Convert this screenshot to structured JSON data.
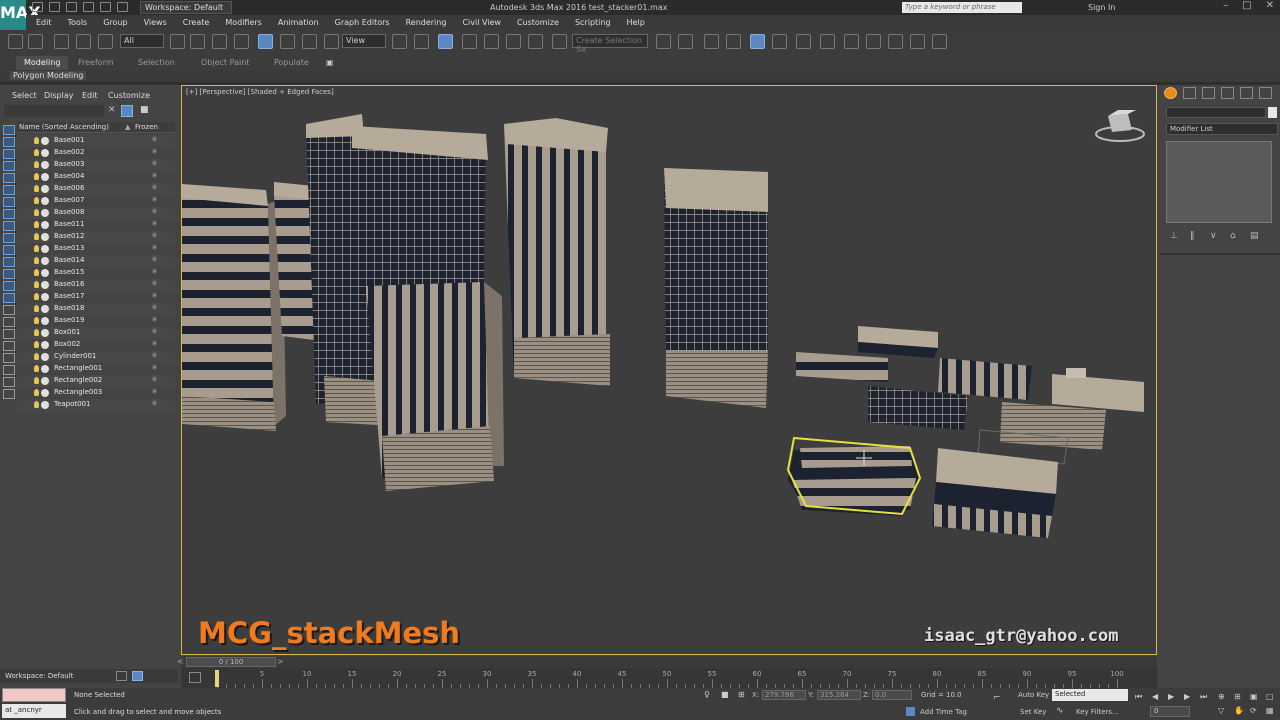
{
  "titlebar": {
    "logo": "MAX",
    "workspace": "Workspace: Default",
    "app_title": "Autodesk 3ds Max 2016     test_stacker01.max",
    "search_placeholder": "Type a keyword or phrase",
    "sign_in": "Sign In"
  },
  "menu": [
    "Edit",
    "Tools",
    "Group",
    "Views",
    "Create",
    "Modifiers",
    "Animation",
    "Graph Editors",
    "Rendering",
    "Civil View",
    "Customize",
    "Scripting",
    "Help"
  ],
  "toolbar": {
    "filter": "All",
    "ref_coord": "View",
    "named_selection": "Create Selection Se"
  },
  "ribbon": {
    "tabs": [
      "Modeling",
      "Freeform",
      "Selection",
      "Object Paint",
      "Populate"
    ],
    "active_tab": "Modeling",
    "subpanel": "Polygon Modeling"
  },
  "explorer": {
    "menu": [
      "Select",
      "Display",
      "Edit",
      "Customize"
    ],
    "col_name": "Name (Sorted Ascending)",
    "col_frozen": "Frozen",
    "objects": [
      "Base001",
      "Base002",
      "Base003",
      "Base004",
      "Base006",
      "Base007",
      "Base008",
      "Base011",
      "Base012",
      "Base013",
      "Base014",
      "Base015",
      "Base016",
      "Base017",
      "Base018",
      "Base019",
      "Box001",
      "Box002",
      "Cylinder001",
      "Rectangle001",
      "Rectangle002",
      "Rectangle003",
      "Teapot001"
    ],
    "workspace": "Workspace: Default"
  },
  "viewport": {
    "label": "[+] [Perspective] [Shaded + Edged Faces]",
    "overlay_title": "MCG_stackMesh",
    "overlay_email": "isaac_gtr@yahoo.com",
    "selection_color": "#e8e03a",
    "building_color": "#a89c8e",
    "window_color": "#1c2230"
  },
  "command_panel": {
    "modifier_list": "Modifier List"
  },
  "timeline": {
    "frame_display": "0 / 100",
    "ticks": [
      0,
      5,
      10,
      15,
      20,
      25,
      30,
      35,
      40,
      45,
      50,
      55,
      60,
      65,
      70,
      75,
      80,
      85,
      90,
      95,
      100
    ]
  },
  "status": {
    "maxscript": "at _ancnyr",
    "selection": "None Selected",
    "prompt": "Click and drag to select and move objects",
    "x_label": "X:",
    "x_value": "279.786",
    "y_label": "Y:",
    "y_value": "315.284",
    "z_label": "Z:",
    "z_value": "0.0",
    "grid": "Grid = 10.0",
    "add_time_tag": "Add Time Tag",
    "auto_key": "Auto Key",
    "set_key": "Set Key",
    "selected": "Selected",
    "key_filters": "Key Filters...",
    "frame": "0"
  }
}
